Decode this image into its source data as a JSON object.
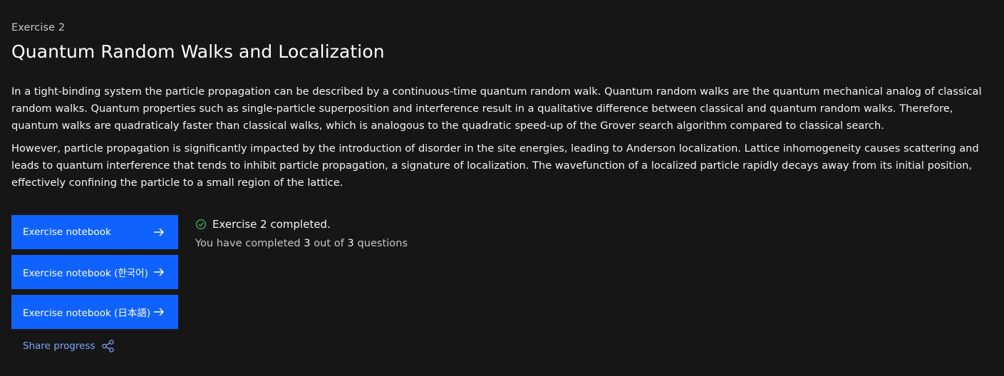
{
  "header": {
    "eyebrow": "Exercise 2",
    "title": "Quantum Random Walks and Localization"
  },
  "description": {
    "paragraphs": [
      "In a tight-binding system the particle propagation can be described by a continuous-time quantum random walk. Quantum random walks are the quantum mechanical analog of classical random walks. Quantum properties such as single-particle superposition and interference result in a qualitative difference between classical and quantum random walks. Therefore, quantum walks are quadraticaly faster than classical walks, which is analogous to the quadratic speed-up of the Grover search algorithm compared to classical search.",
      "However, particle propagation is significantly impacted by the introduction of disorder in the site energies, leading to Anderson localization. Lattice inhomogeneity causes scattering and leads to quantum interference that tends to inhibit particle propagation, a signature of localization. The wavefunction of a localized particle rapidly decays away from its initial position, effectively confining the particle to a small region of the lattice."
    ]
  },
  "actions": {
    "buttons": [
      {
        "label": "Exercise notebook",
        "icon": "arrow-right-icon"
      },
      {
        "label": "Exercise notebook (한국어)",
        "icon": "arrow-right-icon"
      },
      {
        "label": "Exercise notebook (日本語)",
        "icon": "arrow-right-icon"
      }
    ],
    "share_label": "Share progress",
    "share_icon": "share-icon"
  },
  "status": {
    "completed_text": "Exercise 2 completed.",
    "progress_prefix": "You have completed",
    "completed_count": "3",
    "progress_middle": "out of",
    "total_count": "3",
    "progress_suffix": "questions",
    "check_icon": "checkmark-outline-icon"
  },
  "colors": {
    "background": "#161616",
    "button": "#0f62fe",
    "link": "#78a9ff",
    "success": "#42be65"
  }
}
